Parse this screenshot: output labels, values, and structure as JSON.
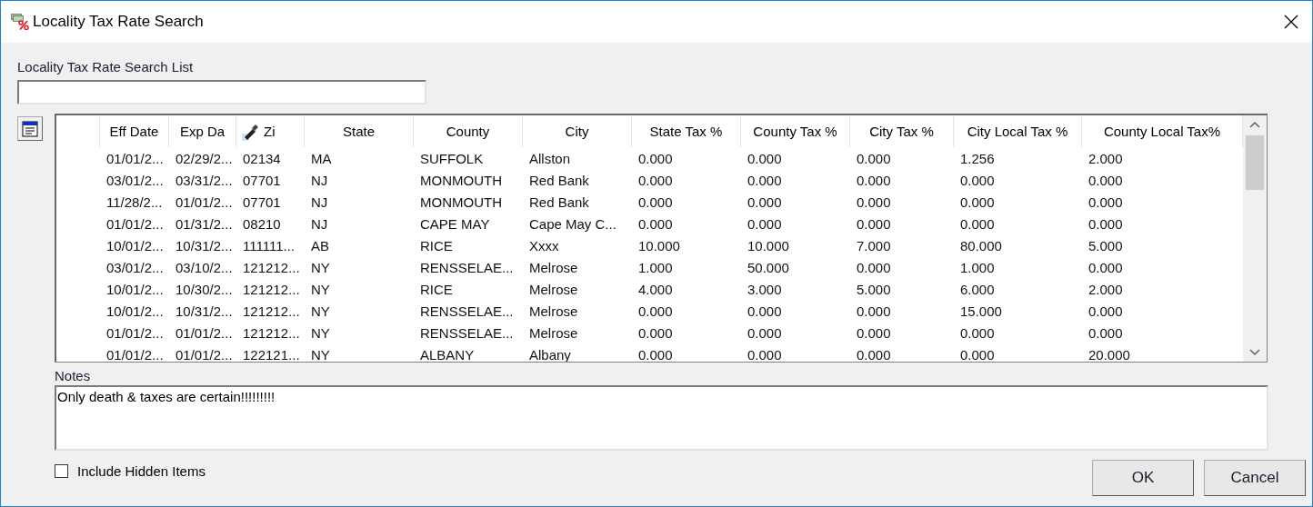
{
  "window": {
    "title": "Locality Tax Rate Search"
  },
  "search": {
    "label": "Locality Tax Rate Search List"
  },
  "table": {
    "columns": [
      {
        "label": "Eff Date",
        "kind": "text"
      },
      {
        "label": "Exp Da",
        "kind": "text"
      },
      {
        "label": "Zi",
        "kind": "search"
      },
      {
        "label": "State",
        "kind": "text"
      },
      {
        "label": "County",
        "kind": "text"
      },
      {
        "label": "City",
        "kind": "text"
      },
      {
        "label": "State Tax %",
        "kind": "text"
      },
      {
        "label": "County Tax %",
        "kind": "text"
      },
      {
        "label": "City Tax %",
        "kind": "text"
      },
      {
        "label": "City Local Tax %",
        "kind": "text"
      },
      {
        "label": "County Local Tax%",
        "kind": "text"
      }
    ],
    "rows": [
      [
        "01/01/2...",
        "02/29/2...",
        "02134",
        "MA",
        "SUFFOLK",
        "Allston",
        "0.000",
        "0.000",
        "0.000",
        "1.256",
        "2.000"
      ],
      [
        "03/01/2...",
        "03/31/2...",
        "07701",
        "NJ",
        "MONMOUTH",
        "Red Bank",
        "0.000",
        "0.000",
        "0.000",
        "0.000",
        "0.000"
      ],
      [
        "11/28/2...",
        "01/01/2...",
        "07701",
        "NJ",
        "MONMOUTH",
        "Red Bank",
        "0.000",
        "0.000",
        "0.000",
        "0.000",
        "0.000"
      ],
      [
        "01/01/2...",
        "01/31/2...",
        "08210",
        "NJ",
        "CAPE MAY",
        "Cape May C...",
        "0.000",
        "0.000",
        "0.000",
        "0.000",
        "0.000"
      ],
      [
        "10/01/2...",
        "10/31/2...",
        "111111...",
        "AB",
        "RICE",
        "Xxxx",
        "10.000",
        "10.000",
        "7.000",
        "80.000",
        "5.000"
      ],
      [
        "03/01/2...",
        "03/10/2...",
        "121212...",
        "NY",
        "RENSSELAE...",
        "Melrose",
        "1.000",
        "50.000",
        "0.000",
        "1.000",
        "0.000"
      ],
      [
        "10/01/2...",
        "10/30/2...",
        "121212...",
        "NY",
        "RICE",
        "Melrose",
        "4.000",
        "3.000",
        "5.000",
        "6.000",
        "2.000"
      ],
      [
        "10/01/2...",
        "10/31/2...",
        "121212...",
        "NY",
        "RENSSELAE...",
        "Melrose",
        "0.000",
        "0.000",
        "0.000",
        "15.000",
        "0.000"
      ],
      [
        "01/01/2...",
        "01/01/2...",
        "121212...",
        "NY",
        "RENSSELAE...",
        "Melrose",
        "0.000",
        "0.000",
        "0.000",
        "0.000",
        "0.000"
      ],
      [
        "01/01/2...",
        "01/01/2...",
        "122121...",
        "NY",
        "ALBANY",
        "Albany",
        "0.000",
        "0.000",
        "0.000",
        "0.000",
        "20.000"
      ]
    ]
  },
  "notes": {
    "label": "Notes",
    "value": "Only death & taxes are certain!!!!!!!!!"
  },
  "include_hidden": {
    "label": "Include Hidden Items",
    "checked": false
  },
  "buttons": [
    "OK",
    "Cancel"
  ]
}
